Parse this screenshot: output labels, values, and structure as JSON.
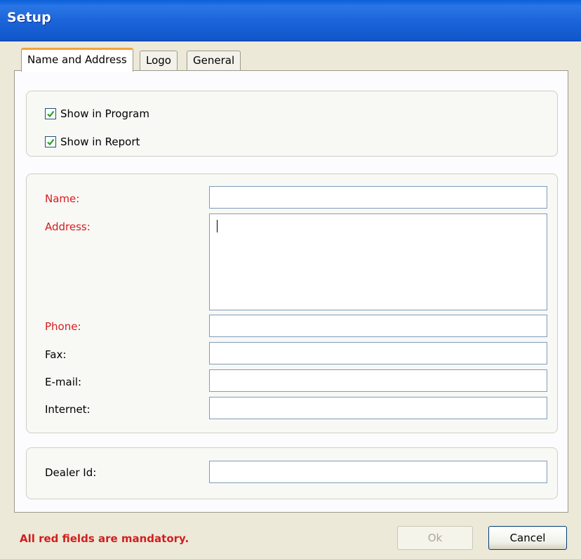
{
  "window": {
    "title": "Setup"
  },
  "tabs": [
    {
      "label": "Name and Address"
    },
    {
      "label": "Logo"
    },
    {
      "label": "General"
    }
  ],
  "visibility": {
    "show_in_program": {
      "label": "Show in Program",
      "checked": true
    },
    "show_in_report": {
      "label": "Show in Report",
      "checked": true
    }
  },
  "fields": {
    "name": {
      "label": "Name:",
      "value": ""
    },
    "address": {
      "label": "Address:",
      "value": ""
    },
    "phone": {
      "label": "Phone:",
      "value": ""
    },
    "fax": {
      "label": "Fax:",
      "value": ""
    },
    "email": {
      "label": "E-mail:",
      "value": ""
    },
    "internet": {
      "label": "Internet:",
      "value": ""
    },
    "dealer_id": {
      "label": "Dealer Id:",
      "value": ""
    }
  },
  "footer": {
    "mandatory_note": "All red fields are mandatory.",
    "ok_label": "Ok",
    "cancel_label": "Cancel"
  },
  "colors": {
    "required_label": "#d21e1e",
    "title_bar": "#1a63d8",
    "active_tab_accent": "#f3a43a",
    "checkmark": "#21a121"
  },
  "icons": {
    "checkbox_mark": "check-mark-icon"
  }
}
